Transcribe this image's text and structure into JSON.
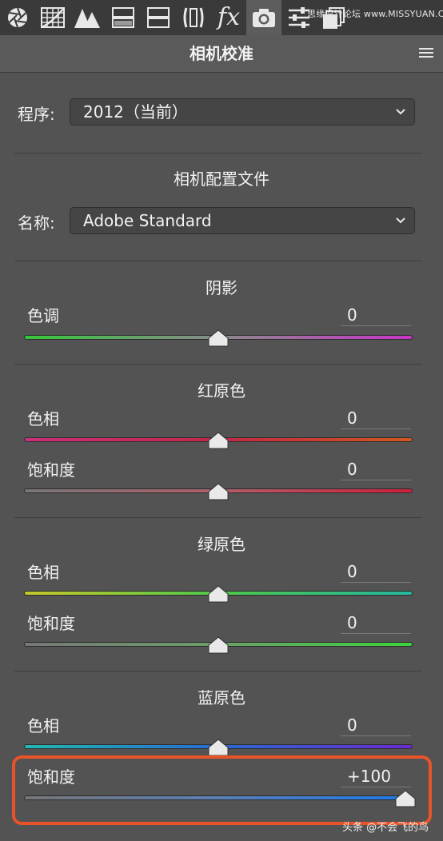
{
  "toolbar": {
    "tabs": [
      {
        "name": "basic-aperture-icon"
      },
      {
        "name": "tone-curve-grid-icon"
      },
      {
        "name": "detail-triangle-icon"
      },
      {
        "name": "hsl-split-icon"
      },
      {
        "name": "split-toning-icon"
      },
      {
        "name": "lens-corrections-icon"
      },
      {
        "name": "fx-effects-icon",
        "label": "fx"
      },
      {
        "name": "camera-calibration-icon",
        "active": true
      },
      {
        "name": "presets-sliders-icon"
      },
      {
        "name": "snapshots-icon"
      }
    ],
    "watermark": "思缘设计论坛 www.MISSYUAN.COM"
  },
  "panel": {
    "title": "相机校准"
  },
  "process": {
    "label": "程序:",
    "value": "2012（当前）"
  },
  "camera_profile": {
    "title": "相机配置文件",
    "label": "名称:",
    "value": "Adobe Standard"
  },
  "sections": [
    {
      "title": "阴影",
      "sliders": [
        {
          "label": "色调",
          "value": "0",
          "fraction": 0.5
        }
      ]
    },
    {
      "title": "红原色",
      "sliders": [
        {
          "label": "色相",
          "value": "0",
          "fraction": 0.5
        },
        {
          "label": "饱和度",
          "value": "0",
          "fraction": 0.5
        }
      ]
    },
    {
      "title": "绿原色",
      "sliders": [
        {
          "label": "色相",
          "value": "0",
          "fraction": 0.5
        },
        {
          "label": "饱和度",
          "value": "0",
          "fraction": 0.5
        }
      ]
    },
    {
      "title": "蓝原色",
      "sliders": [
        {
          "label": "色相",
          "value": "0",
          "fraction": 0.5
        },
        {
          "label": "饱和度",
          "value": "+100",
          "fraction": 1.0
        }
      ]
    }
  ],
  "colors": {
    "highlight": "#e8532a",
    "background": "#535353",
    "toolbar": "#3a3a3a"
  },
  "footer_watermark": "头条 @不会飞的鸟"
}
